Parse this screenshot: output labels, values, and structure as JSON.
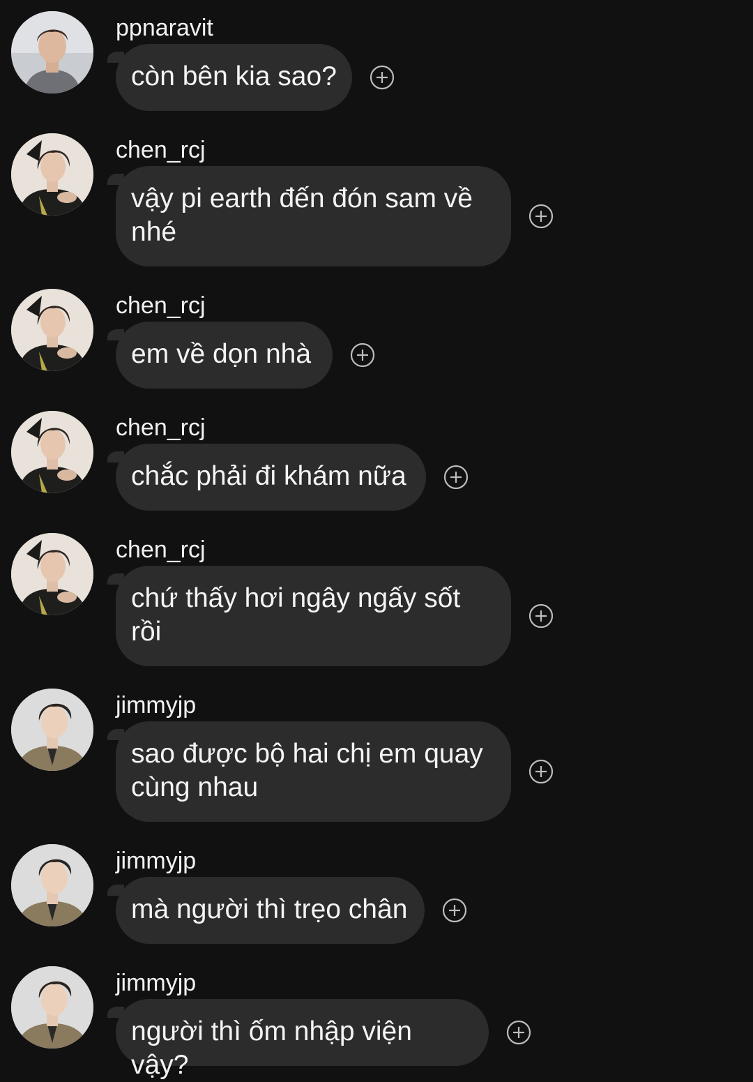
{
  "colors": {
    "background": "#111111",
    "bubble": "#2c2c2c",
    "text": "#f4f4f4",
    "react_icon": "#bdbdbd"
  },
  "messages": [
    {
      "username": "ppnaravit",
      "text": "còn bên kia sao?",
      "avatar": "ppnaravit-avatar",
      "icon": "add-reaction-icon"
    },
    {
      "username": "chen_rcj",
      "text": "vậy pi earth đến đón sam về nhé",
      "avatar": "chen_rcj-avatar",
      "icon": "add-reaction-icon"
    },
    {
      "username": "chen_rcj",
      "text": "em về dọn nhà",
      "avatar": "chen_rcj-avatar",
      "icon": "add-reaction-icon"
    },
    {
      "username": "chen_rcj",
      "text": "chắc phải đi khám nữa",
      "avatar": "chen_rcj-avatar",
      "icon": "add-reaction-icon"
    },
    {
      "username": "chen_rcj",
      "text": "chứ thấy hơi ngây ngấy sốt rồi",
      "avatar": "chen_rcj-avatar",
      "icon": "add-reaction-icon"
    },
    {
      "username": "jimmyjp",
      "text": "sao được bộ hai chị em quay cùng nhau",
      "avatar": "jimmyjp-avatar",
      "icon": "add-reaction-icon"
    },
    {
      "username": "jimmyjp",
      "text": "mà người thì trẹo chân",
      "avatar": "jimmyjp-avatar",
      "icon": "add-reaction-icon"
    },
    {
      "username": "jimmyjp",
      "text": "người thì ốm nhập viện vậy?",
      "avatar": "jimmyjp-avatar",
      "icon": "add-reaction-icon"
    }
  ]
}
